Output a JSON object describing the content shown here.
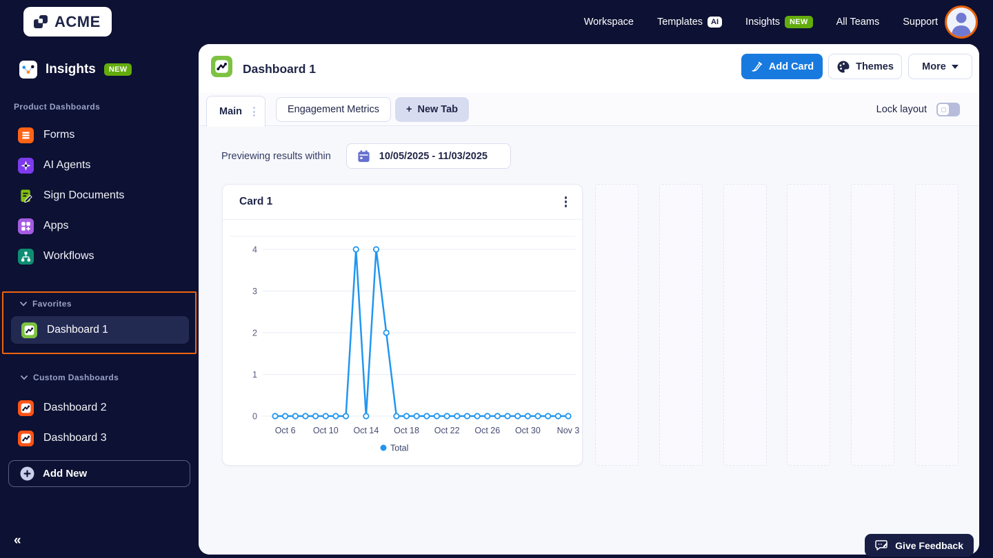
{
  "brand": {
    "name": "ACME"
  },
  "topnav": {
    "items": [
      {
        "label": "Workspace",
        "badge": null
      },
      {
        "label": "Templates",
        "badge": "AI"
      },
      {
        "label": "Insights",
        "badge": "NEW"
      },
      {
        "label": "All Teams",
        "badge": null
      },
      {
        "label": "Support",
        "badge": null
      }
    ]
  },
  "sidebar": {
    "app_title": "Insights",
    "app_badge": "NEW",
    "product_section_label": "Product Dashboards",
    "product_items": [
      {
        "label": "Forms",
        "icon": "forms-icon",
        "color": "#FF6316"
      },
      {
        "label": "AI Agents",
        "icon": "ai-agents-icon",
        "color": "#7D3BEC"
      },
      {
        "label": "Sign Documents",
        "icon": "sign-documents-icon",
        "color": "#84BF10"
      },
      {
        "label": "Apps",
        "icon": "apps-icon",
        "color": "#A55BE3"
      },
      {
        "label": "Workflows",
        "icon": "workflows-icon",
        "color": "#0F8D73"
      }
    ],
    "favorites_section_label": "Favorites",
    "favorites_items": [
      {
        "label": "Dashboard 1",
        "icon": "dashboard-icon",
        "color": "#7DC242",
        "selected": true
      }
    ],
    "custom_section_label": "Custom Dashboards",
    "custom_items": [
      {
        "label": "Dashboard 2",
        "icon": "dashboard-icon",
        "color": "#FF5316",
        "selected": false
      },
      {
        "label": "Dashboard 3",
        "icon": "dashboard-icon",
        "color": "#FF5316",
        "selected": false
      }
    ],
    "add_new_label": "Add New",
    "collapse_glyph": "«"
  },
  "header": {
    "title": "Dashboard 1",
    "add_card_label": "Add Card",
    "themes_label": "Themes",
    "more_label": "More"
  },
  "tabs": {
    "active_tab": "Main",
    "second_tab": "Engagement Metrics",
    "new_tab_plus": "+",
    "new_tab_label": "New Tab",
    "lock_layout_label": "Lock layout",
    "lock_layout_on": false
  },
  "filter": {
    "label": "Previewing results within",
    "date_range": "10/05/2025 - 11/03/2025"
  },
  "card": {
    "title": "Card 1"
  },
  "chart_data": {
    "type": "line",
    "title": "Card 1",
    "x": [
      "Oct 5",
      "Oct 6",
      "Oct 7",
      "Oct 8",
      "Oct 9",
      "Oct 10",
      "Oct 11",
      "Oct 12",
      "Oct 13",
      "Oct 14",
      "Oct 15",
      "Oct 16",
      "Oct 17",
      "Oct 18",
      "Oct 19",
      "Oct 20",
      "Oct 21",
      "Oct 22",
      "Oct 23",
      "Oct 24",
      "Oct 25",
      "Oct 26",
      "Oct 27",
      "Oct 28",
      "Oct 29",
      "Oct 30",
      "Oct 31",
      "Nov 1",
      "Nov 2",
      "Nov 3"
    ],
    "series": [
      {
        "name": "Total",
        "color": "#2196F0",
        "values": [
          0,
          0,
          0,
          0,
          0,
          0,
          0,
          0,
          4,
          0,
          4,
          2,
          0,
          0,
          0,
          0,
          0,
          0,
          0,
          0,
          0,
          0,
          0,
          0,
          0,
          0,
          0,
          0,
          0,
          0
        ]
      }
    ],
    "x_tick_labels": [
      "Oct 6",
      "Oct 10",
      "Oct 14",
      "Oct 18",
      "Oct 22",
      "Oct 26",
      "Oct 30",
      "Nov 3"
    ],
    "y_ticks": [
      0,
      1,
      2,
      3,
      4
    ],
    "ylim": [
      0,
      4
    ],
    "grid": true,
    "legend_position": "bottom"
  },
  "placeholders": {
    "count": 6
  },
  "feedback": {
    "label": "Give Feedback"
  },
  "colors": {
    "navy_bg": "#0D1133",
    "accent_blue": "#187ADF",
    "chart_blue": "#2196F0",
    "highlight_orange": "#F0640F",
    "badge_green": "#63AC0D",
    "dashboard_green": "#7DC242",
    "dashboard_orange": "#FF5316",
    "content_bg": "#F7F8FC"
  }
}
